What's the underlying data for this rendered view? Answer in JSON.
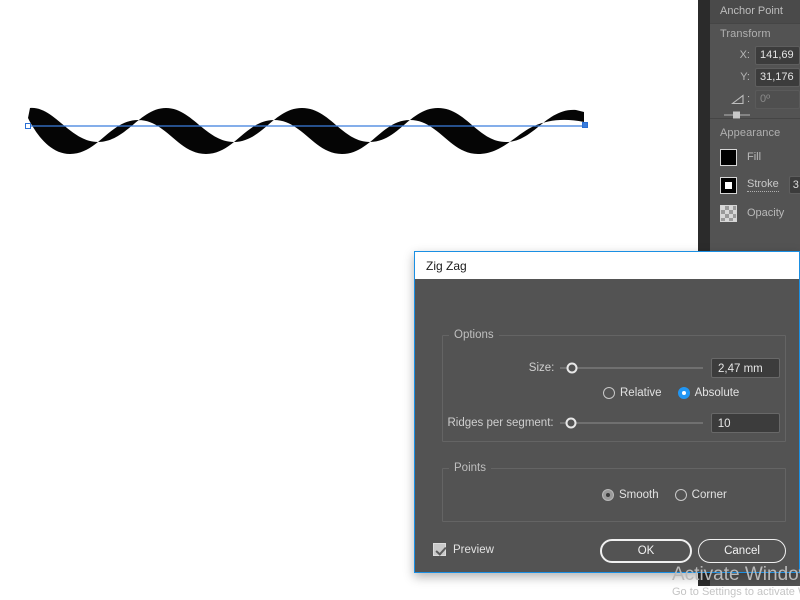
{
  "canvas": {
    "artwork_name": "zigzag-wave-path",
    "selection_color": "#3a7ddd",
    "fill_color": "#000000",
    "background": "#ffffff"
  },
  "right_panel": {
    "anchor_point_header": "Anchor Point",
    "transform": {
      "title": "Transform",
      "x_label": "X:",
      "x_value": "141,69",
      "y_label": "Y:",
      "y_value": "31,176",
      "angle_label": "◿:",
      "angle_value": "0º",
      "reference_point_name": "reference-point-widget"
    },
    "appearance": {
      "title": "Appearance",
      "rows": [
        {
          "label": "Fill",
          "swatch": "black-swatch",
          "value": ""
        },
        {
          "label": "Stroke",
          "swatch": "stroke-swatch",
          "value": "3"
        },
        {
          "label": "Opacity",
          "swatch": "opacity-checker-swatch",
          "value": ""
        }
      ]
    }
  },
  "dialog": {
    "title": "Zig Zag",
    "options": {
      "legend": "Options",
      "size": {
        "label": "Size:",
        "value": "2,47 mm",
        "slider_percent": 4
      },
      "mode": {
        "selected": "Absolute",
        "choices": [
          "Relative",
          "Absolute"
        ]
      },
      "ridges": {
        "label": "Ridges per segment:",
        "value": "10",
        "slider_percent": 4
      }
    },
    "points": {
      "legend": "Points",
      "selected": "Smooth",
      "choices": [
        "Smooth",
        "Corner"
      ]
    },
    "footer": {
      "preview_label": "Preview",
      "preview_checked": true,
      "ok_label": "OK",
      "cancel_label": "Cancel"
    },
    "accent_color": "#1a8fe3",
    "radio_accent": "#2196f3"
  },
  "watermark": {
    "line1": "Activate Windows",
    "line2": "Go to Settings to activate Windows."
  }
}
